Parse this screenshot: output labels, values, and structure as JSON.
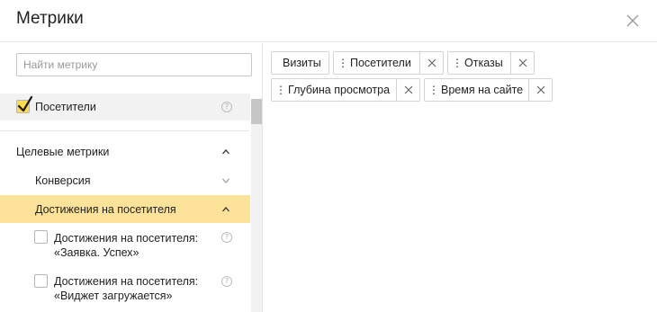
{
  "dialog": {
    "title": "Метрики"
  },
  "search": {
    "placeholder": "Найти метрику",
    "value": ""
  },
  "left": {
    "selected_item": {
      "label": "Посетители",
      "checked": true,
      "help": "?"
    },
    "group": {
      "label": "Целевые метрики",
      "expanded": true,
      "items": [
        {
          "label": "Конверсия",
          "expanded": false
        },
        {
          "label": "Достижения на посетителя",
          "expanded": true,
          "active": true
        }
      ],
      "subitems": [
        {
          "line1": "Достижения на посетителя:",
          "line2": "«Заявка. Успех»",
          "checked": false,
          "help": "?"
        },
        {
          "line1": "Достижения на посетителя:",
          "line2": "«Виджет загружается»",
          "checked": false,
          "help": "?"
        }
      ]
    }
  },
  "selected_metrics": [
    {
      "label": "Визиты",
      "removable": false,
      "draggable": false
    },
    {
      "label": "Посетители",
      "removable": true,
      "draggable": true
    },
    {
      "label": "Отказы",
      "removable": true,
      "draggable": true
    },
    {
      "label": "Глубина просмотра",
      "removable": true,
      "draggable": true
    },
    {
      "label": "Время на сайте",
      "removable": true,
      "draggable": true
    }
  ],
  "colors": {
    "accent_yellow": "#ffdb4d",
    "active_row": "#fde39a",
    "border": "#d4d4d4"
  }
}
